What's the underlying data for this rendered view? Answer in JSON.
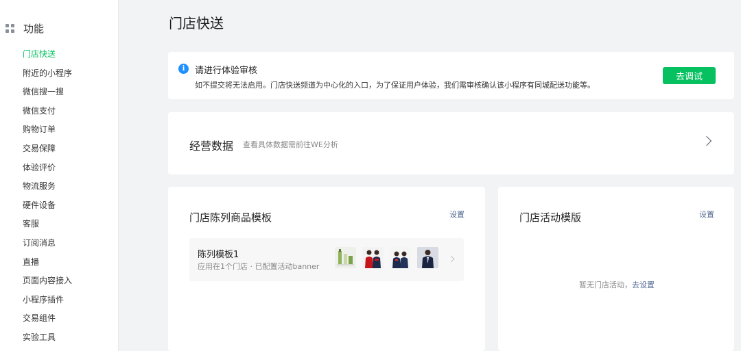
{
  "sidebar": {
    "title": "功能",
    "icon": "grid-icon",
    "items": [
      {
        "label": "门店快送",
        "active": true
      },
      {
        "label": "附近的小程序"
      },
      {
        "label": "微信搜一搜"
      },
      {
        "label": "微信支付"
      },
      {
        "label": "购物订单"
      },
      {
        "label": "交易保障"
      },
      {
        "label": "体验评价"
      },
      {
        "label": "物流服务"
      },
      {
        "label": "硬件设备"
      },
      {
        "label": "客服"
      },
      {
        "label": "订阅消息"
      },
      {
        "label": "直播"
      },
      {
        "label": "页面内容接入"
      },
      {
        "label": "小程序插件"
      },
      {
        "label": "交易组件"
      },
      {
        "label": "实验工具"
      }
    ]
  },
  "page": {
    "title": "门店快送"
  },
  "review": {
    "icon": "info-icon",
    "title": "请进行体验审核",
    "description": "如不提交将无法启用。门店快送频道为中心化的入口，为了保证用户体验，我们需审核确认该小程序有同城配送功能等。",
    "button_label": "去调试"
  },
  "stats": {
    "title": "经营数据",
    "hint": "查看具体数据需前往WE分析",
    "icon": "chevron-right-icon"
  },
  "display_template": {
    "title": "门店陈列商品模板",
    "setting_label": "设置",
    "item": {
      "name": "陈列模板1",
      "description": "应用在1个门店 · 已配置活动banner",
      "thumbnails": [
        "product-bottles",
        "red-jacket-people",
        "navy-shirt-people",
        "suit-man"
      ]
    }
  },
  "activity_template": {
    "title": "门店活动模版",
    "setting_label": "设置",
    "empty_text": "暂无门店活动，",
    "empty_link": "去设置"
  },
  "colors": {
    "accent": "#07c160",
    "link": "#576b95",
    "info": "#1e90ff",
    "background": "#f2f3f5"
  }
}
